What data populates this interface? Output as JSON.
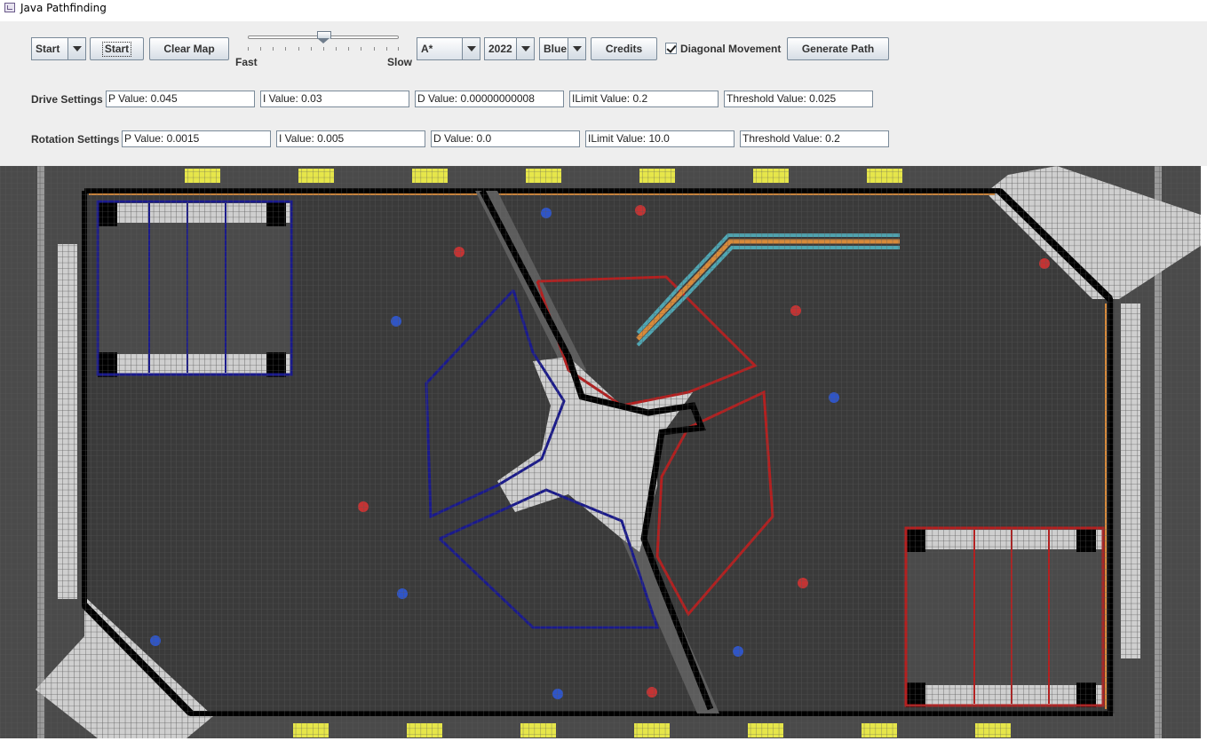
{
  "window": {
    "title": "Java Pathfinding"
  },
  "toolbar": {
    "mode_select": {
      "selected": "Start"
    },
    "start_button": "Start",
    "clear_map_button": "Clear Map",
    "speed_slider": {
      "min_label": "Fast",
      "max_label": "Slow",
      "value_fraction": 0.51
    },
    "algorithm_select": {
      "selected": "A*"
    },
    "year_select": {
      "selected": "2022"
    },
    "alliance_select": {
      "selected": "Blue"
    },
    "credits_button": "Credits",
    "diagonal_movement": {
      "label": "Diagonal Movement",
      "checked": true
    },
    "generate_path_button": "Generate Path"
  },
  "drive_settings": {
    "label": "Drive Settings",
    "p_value": "P Value: 0.045",
    "i_value": "I Value: 0.03",
    "d_value": "D Value: 0.00000000008",
    "ilimit_value": "ILimit Value: 0.2",
    "threshold_value": "Threshold Value: 0.025"
  },
  "rotation_settings": {
    "label": "Rotation Settings",
    "p_value": "P Value: 0.0015",
    "i_value": "I Value: 0.005",
    "d_value": "D Value: 0.0",
    "ilimit_value": "ILimit Value: 10.0",
    "threshold_value": "Threshold Value: 0.2"
  },
  "colors": {
    "panel_bg": "#eeeeee",
    "field_bg": "#3a3a3a",
    "grid_line": "#555555",
    "wall": "#000000",
    "blue_alliance": "#1a1a8c",
    "red_alliance": "#b51f1f",
    "blue_cargo": "#2f55c7",
    "red_cargo": "#c43333",
    "path_orange": "#d88a3a",
    "path_cyan": "#4fa6b3"
  }
}
